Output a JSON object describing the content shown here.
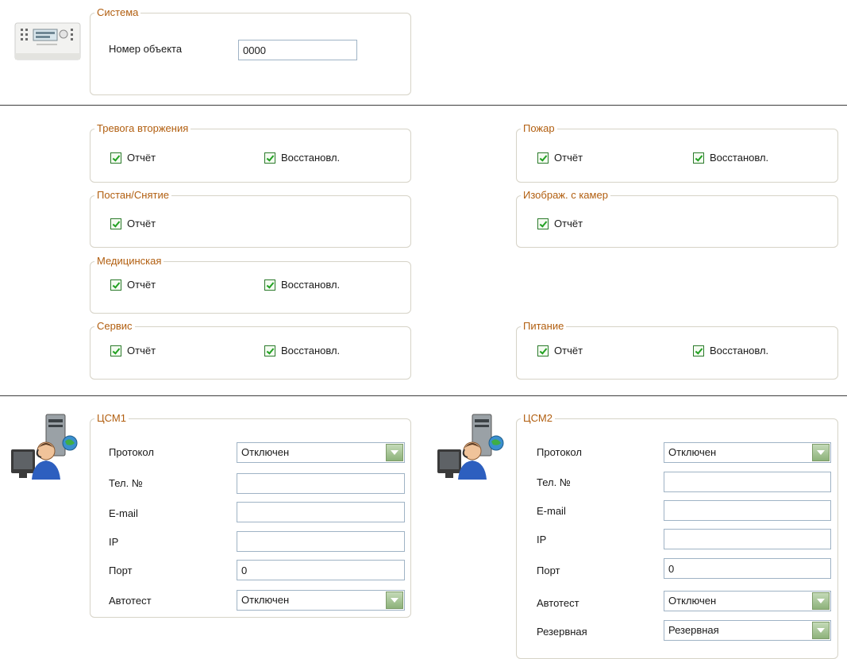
{
  "system": {
    "legend": "Система",
    "object_number_label": "Номер объекта",
    "object_number_value": "0000"
  },
  "events": {
    "intrusion": {
      "legend": "Тревога вторжения",
      "report": "Отчёт",
      "restore": "Восстановл."
    },
    "arm_disarm": {
      "legend": "Постан/Снятие",
      "report": "Отчёт"
    },
    "medical": {
      "legend": "Медицинская",
      "report": "Отчёт",
      "restore": "Восстановл."
    },
    "service": {
      "legend": "Сервис",
      "report": "Отчёт",
      "restore": "Восстановл."
    },
    "fire": {
      "legend": "Пожар",
      "report": "Отчёт",
      "restore": "Восстановл."
    },
    "camera": {
      "legend": "Изображ. с камер",
      "report": "Отчёт"
    },
    "power": {
      "legend": "Питание",
      "report": "Отчёт",
      "restore": "Восстановл."
    }
  },
  "cms1": {
    "legend": "ЦСМ1",
    "protocol_label": "Протокол",
    "protocol_value": "Отключен",
    "phone_label": "Тел. №",
    "phone_value": "",
    "email_label": "E-mail",
    "email_value": "",
    "ip_label": "IP",
    "ip_value": "",
    "port_label": "Порт",
    "port_value": "0",
    "autotest_label": "Автотест",
    "autotest_value": "Отключен"
  },
  "cms2": {
    "legend": "ЦСМ2",
    "protocol_label": "Протокол",
    "protocol_value": "Отключен",
    "phone_label": "Тел. №",
    "phone_value": "",
    "email_label": "E-mail",
    "email_value": "",
    "ip_label": "IP",
    "ip_value": "",
    "port_label": "Порт",
    "port_value": "0",
    "autotest_label": "Автотест",
    "autotest_value": "Отключен",
    "backup_label": "Резервная",
    "backup_value": "Резервная"
  },
  "icons": {
    "panel": "control-panel-icon",
    "operator": "monitoring-operator-icon"
  },
  "colors": {
    "legend": "#b15e0f",
    "check": "#21a121",
    "dropdown": "#8db27a"
  }
}
